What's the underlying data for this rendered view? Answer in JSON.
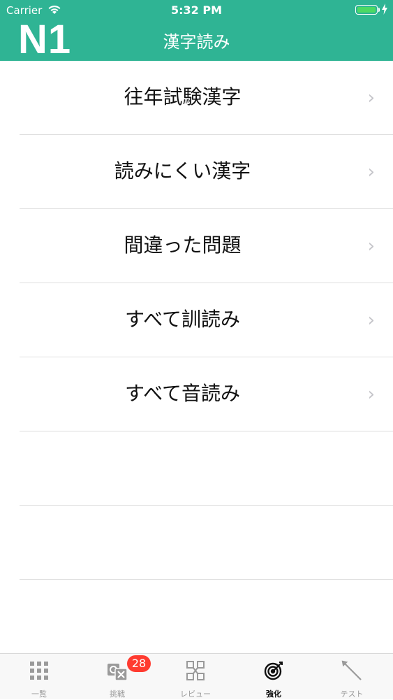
{
  "status_bar": {
    "carrier": "Carrier",
    "time": "5:32 PM",
    "battery_color": "#4cd964"
  },
  "header": {
    "logo": "N1",
    "title": "漢字読み",
    "color": "#2fb494"
  },
  "list": {
    "items": [
      {
        "label": "往年試験漢字"
      },
      {
        "label": "読みにくい漢字"
      },
      {
        "label": "間違った問題"
      },
      {
        "label": "すべて訓読み"
      },
      {
        "label": "すべて音読み"
      }
    ],
    "chevron": "›"
  },
  "tabbar": {
    "tabs": [
      {
        "label": "一覧",
        "icon": "grid-icon"
      },
      {
        "label": "挑戦",
        "icon": "challenge-icon",
        "badge": "28"
      },
      {
        "label": "レビュー",
        "icon": "review-icon"
      },
      {
        "label": "強化",
        "icon": "target-icon",
        "active": true
      },
      {
        "label": "テスト",
        "icon": "pencil-icon"
      }
    ]
  }
}
